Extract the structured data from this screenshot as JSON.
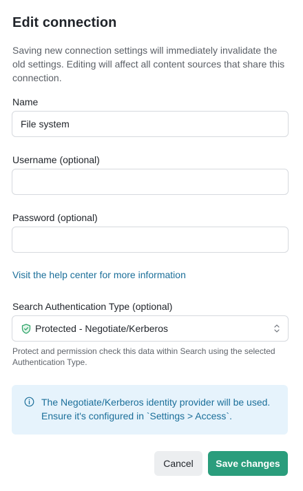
{
  "dialog": {
    "title": "Edit connection",
    "description": "Saving new connection settings will immediately invalidate the old settings. Editing will affect all content sources that share this connection."
  },
  "fields": {
    "name": {
      "label": "Name",
      "value": "File system"
    },
    "username": {
      "label": "Username (optional)",
      "value": ""
    },
    "password": {
      "label": "Password (optional)",
      "value": ""
    }
  },
  "help_link": "Visit the help center for more information",
  "auth": {
    "label": "Search Authentication Type (optional)",
    "selected": "Protected - Negotiate/Kerberos",
    "icon": "shield-check-icon",
    "hint": "Protect and permission check this data within Search using the selected Authentication Type."
  },
  "callout": {
    "icon": "info-icon",
    "text": "The Negotiate/Kerberos identity provider will be used. Ensure it's configured in `Settings > Access`."
  },
  "actions": {
    "cancel": "Cancel",
    "save": "Save changes"
  },
  "colors": {
    "primary": "#2a9d7c",
    "link": "#1a6e99",
    "callout_bg": "#e6f3fc",
    "shield": "#2fa56a"
  }
}
